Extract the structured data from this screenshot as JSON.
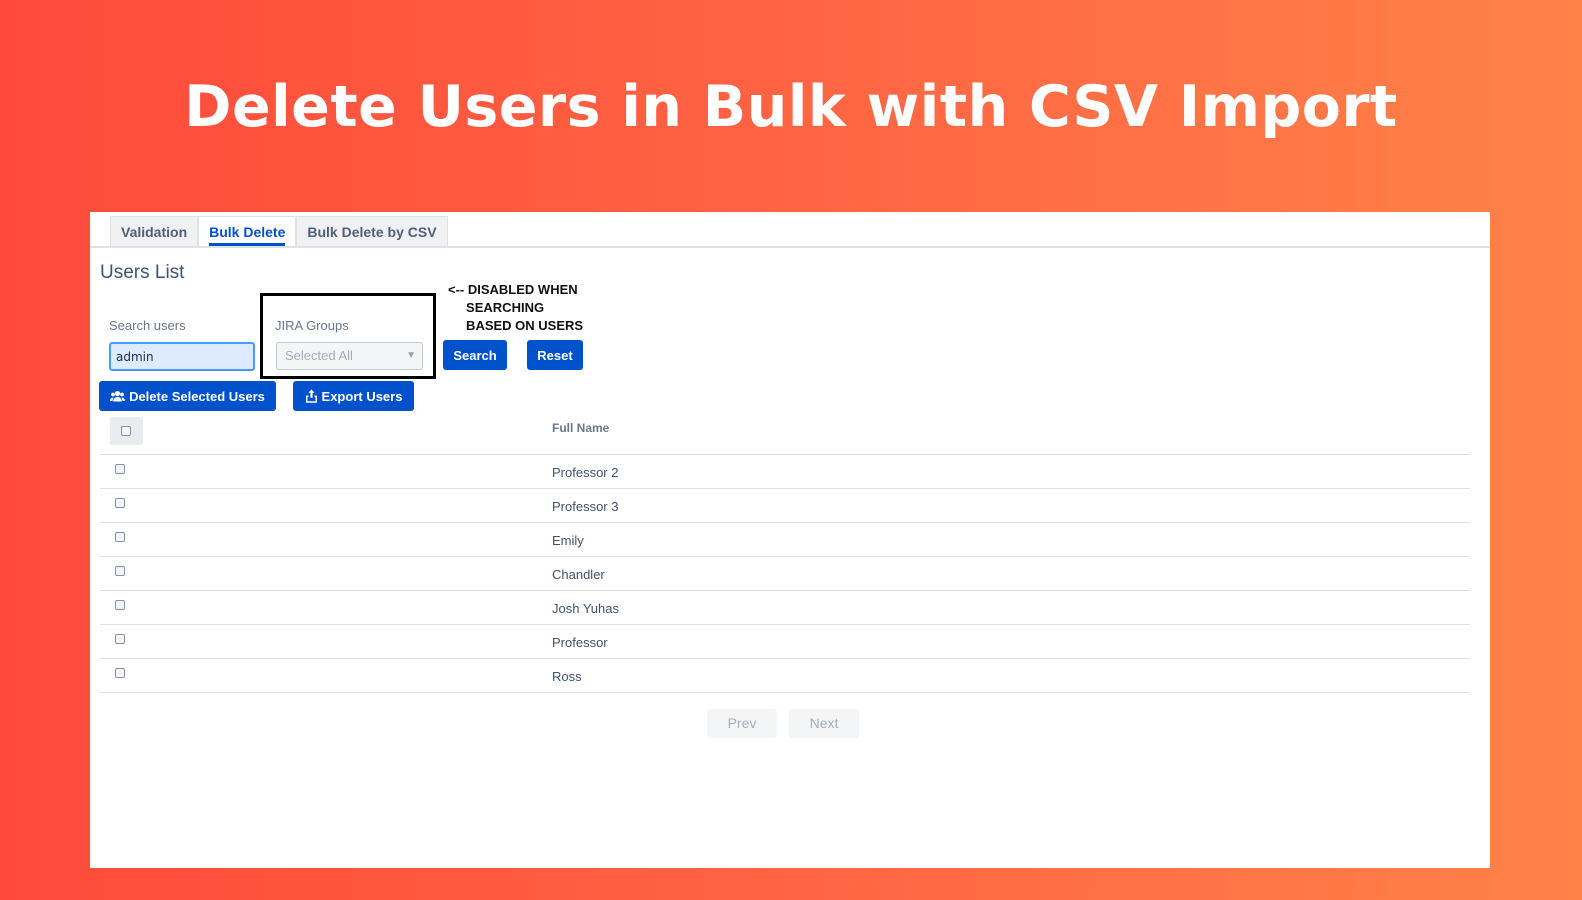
{
  "headline": "Delete Users in Bulk with CSV Import",
  "tabs": [
    {
      "label": "Validation",
      "active": false
    },
    {
      "label": "Bulk Delete",
      "active": true
    },
    {
      "label": "Bulk Delete by CSV",
      "active": false
    }
  ],
  "users_title": "Users List",
  "annotation": "<-- DISABLED WHEN\n     SEARCHING\n     BASED ON USERS",
  "search": {
    "label": "Search users",
    "value": "admin"
  },
  "groups": {
    "label": "JIRA Groups",
    "selected": "Selected All"
  },
  "buttons": {
    "search": "Search",
    "reset": "Reset",
    "delete_selected": "Delete Selected Users",
    "export": "Export Users"
  },
  "table": {
    "column": "Full Name",
    "rows": [
      "Professor  2",
      "Professor  3",
      "Emily",
      "Chandler",
      "Josh Yuhas",
      "Professor",
      "Ross"
    ]
  },
  "pager": {
    "prev": "Prev",
    "next": "Next"
  },
  "colors": {
    "accent": "#0052cc",
    "bg_start": "#ff4a3b",
    "bg_end": "#ff8249"
  }
}
